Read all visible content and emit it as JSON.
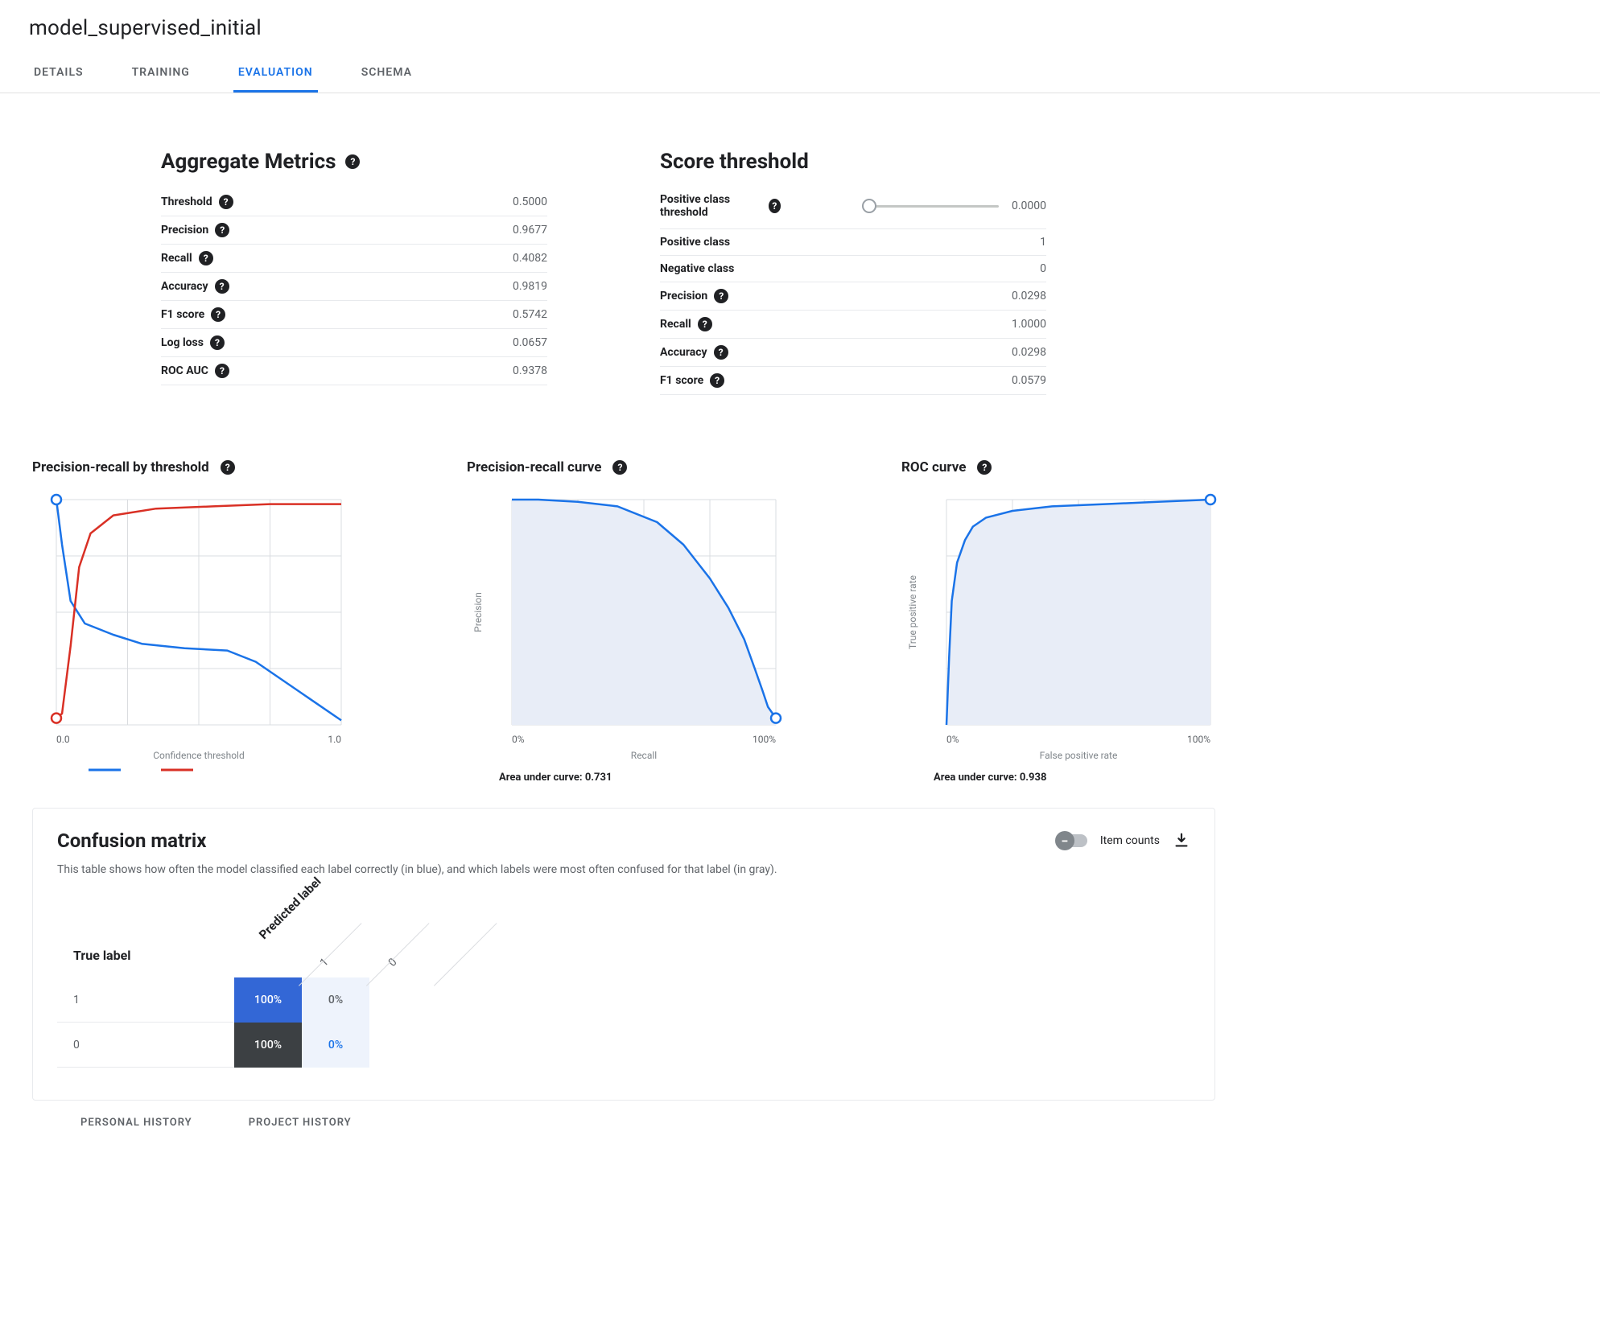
{
  "header": {
    "title": "model_supervised_initial"
  },
  "tabs": [
    "DETAILS",
    "TRAINING",
    "EVALUATION",
    "SCHEMA"
  ],
  "active_tab": 2,
  "aggregate": {
    "title": "Aggregate Metrics",
    "rows": [
      {
        "label": "Threshold",
        "value": "0.5000",
        "help": true
      },
      {
        "label": "Precision",
        "value": "0.9677",
        "help": true
      },
      {
        "label": "Recall",
        "value": "0.4082",
        "help": true
      },
      {
        "label": "Accuracy",
        "value": "0.9819",
        "help": true
      },
      {
        "label": "F1 score",
        "value": "0.5742",
        "help": true
      },
      {
        "label": "Log loss",
        "value": "0.0657",
        "help": true
      },
      {
        "label": "ROC AUC",
        "value": "0.9378",
        "help": true
      }
    ]
  },
  "score_threshold": {
    "title": "Score threshold",
    "slider_label": "Positive class threshold",
    "slider_value": "0.0000",
    "rows": [
      {
        "label": "Positive class",
        "value": "1",
        "help": false
      },
      {
        "label": "Negative class",
        "value": "0",
        "help": false
      },
      {
        "label": "Precision",
        "value": "0.0298",
        "help": true
      },
      {
        "label": "Recall",
        "value": "1.0000",
        "help": true
      },
      {
        "label": "Accuracy",
        "value": "0.0298",
        "help": true
      },
      {
        "label": "F1 score",
        "value": "0.0579",
        "help": true
      }
    ]
  },
  "charts": {
    "pr_threshold": {
      "title": "Precision-recall by threshold",
      "xlabel": "Confidence threshold",
      "x_ticks": [
        "0.0",
        "1.0"
      ]
    },
    "pr_curve": {
      "title": "Precision-recall curve",
      "xlabel": "Recall",
      "ylabel": "Precision",
      "x_ticks": [
        "0%",
        "100%"
      ],
      "auc_label": "Area under curve: 0.731"
    },
    "roc_curve": {
      "title": "ROC curve",
      "xlabel": "False positive rate",
      "ylabel": "True positive rate",
      "x_ticks": [
        "0%",
        "100%"
      ],
      "auc_label": "Area under curve: 0.938"
    }
  },
  "confusion": {
    "title": "Confusion matrix",
    "toggle_label": "Item counts",
    "description": "This table shows how often the model classified each label correctly (in blue), and which labels were most often confused for that label (in gray).",
    "predicted_label": "Predicted label",
    "true_label": "True label",
    "col_headers": [
      "1",
      "0"
    ],
    "rows": [
      {
        "label": "1",
        "cells": [
          "100%",
          "0%"
        ]
      },
      {
        "label": "0",
        "cells": [
          "100%",
          "0%"
        ]
      }
    ]
  },
  "footer_tabs": [
    "PERSONAL HISTORY",
    "PROJECT HISTORY"
  ],
  "chart_data": [
    {
      "type": "line",
      "title": "Precision-recall by threshold",
      "xlabel": "Confidence threshold",
      "ylabel": "",
      "xlim": [
        0,
        1
      ],
      "ylim": [
        0,
        1
      ],
      "series": [
        {
          "name": "Recall (blue)",
          "x": [
            0.0,
            0.02,
            0.05,
            0.1,
            0.2,
            0.3,
            0.45,
            0.6,
            0.7,
            0.85,
            1.0
          ],
          "y": [
            1.0,
            0.8,
            0.55,
            0.45,
            0.4,
            0.36,
            0.34,
            0.33,
            0.28,
            0.15,
            0.02
          ]
        },
        {
          "name": "Precision (red)",
          "x": [
            0.0,
            0.02,
            0.05,
            0.08,
            0.12,
            0.2,
            0.35,
            0.55,
            0.75,
            1.0
          ],
          "y": [
            0.03,
            0.05,
            0.35,
            0.7,
            0.85,
            0.93,
            0.96,
            0.97,
            0.98,
            0.98
          ]
        }
      ]
    },
    {
      "type": "line",
      "title": "Precision-recall curve",
      "xlabel": "Recall",
      "ylabel": "Precision",
      "xlim": [
        0,
        1
      ],
      "ylim": [
        0,
        1
      ],
      "area_under_curve": 0.731,
      "series": [
        {
          "name": "PR",
          "x": [
            0.0,
            0.1,
            0.25,
            0.4,
            0.55,
            0.65,
            0.75,
            0.82,
            0.88,
            0.92,
            0.95,
            0.97,
            1.0
          ],
          "y": [
            1.0,
            1.0,
            0.99,
            0.97,
            0.9,
            0.8,
            0.65,
            0.52,
            0.38,
            0.25,
            0.15,
            0.08,
            0.03
          ]
        }
      ]
    },
    {
      "type": "line",
      "title": "ROC curve",
      "xlabel": "False positive rate",
      "ylabel": "True positive rate",
      "xlim": [
        0,
        1
      ],
      "ylim": [
        0,
        1
      ],
      "area_under_curve": 0.938,
      "series": [
        {
          "name": "ROC",
          "x": [
            0.0,
            0.01,
            0.02,
            0.04,
            0.07,
            0.1,
            0.15,
            0.25,
            0.4,
            0.6,
            0.8,
            1.0
          ],
          "y": [
            0.0,
            0.3,
            0.55,
            0.72,
            0.82,
            0.88,
            0.92,
            0.95,
            0.97,
            0.98,
            0.99,
            1.0
          ]
        }
      ]
    }
  ],
  "colors": {
    "blue": "#1a73e8",
    "red": "#d93025",
    "grid": "#dadce0",
    "fill": "#e8edf7",
    "cm_on_blue": "#3367d6",
    "cm_off_blue": "#eef3fc",
    "cm_gray": "#3c4043"
  }
}
